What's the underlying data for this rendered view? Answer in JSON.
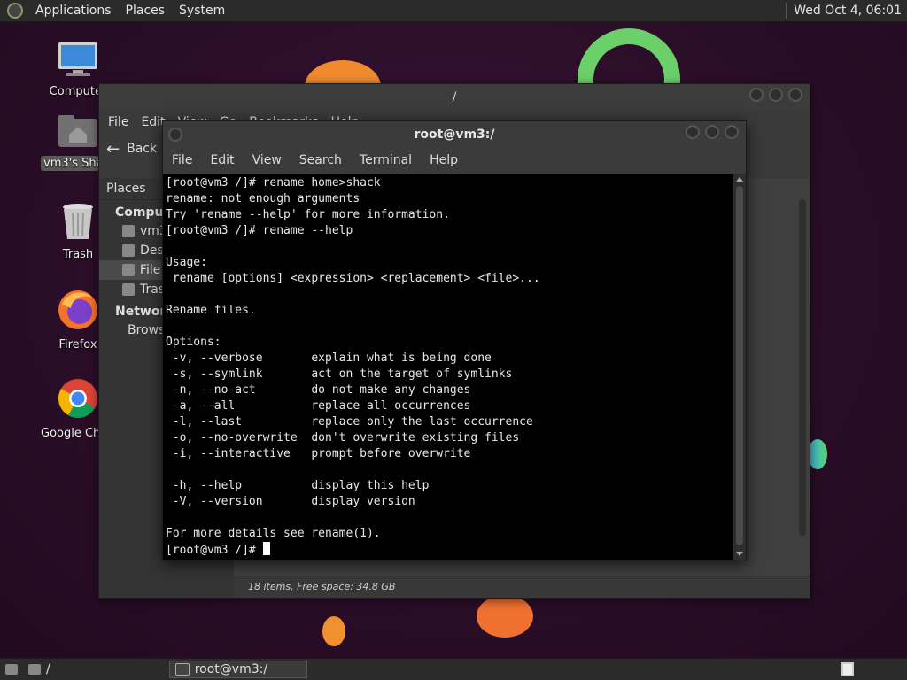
{
  "top_panel": {
    "menus": [
      "Applications",
      "Places",
      "System"
    ],
    "clock": "Wed Oct  4, 06:01"
  },
  "desktop": {
    "icons": [
      {
        "label": "Computer",
        "icon": "computer-icon"
      },
      {
        "label": "vm3's Shared",
        "icon": "home-folder-icon"
      },
      {
        "label": "Trash",
        "icon": "trash-icon"
      },
      {
        "label": "Firefox",
        "icon": "firefox-icon"
      },
      {
        "label": "Google Chrome",
        "icon": "chrome-icon"
      }
    ]
  },
  "file_manager": {
    "title": "/",
    "menus": [
      "File",
      "Edit",
      "View",
      "Go",
      "Bookmarks",
      "Help"
    ],
    "back_label": "Back",
    "sidebar_header": "Places",
    "section_computer": "Computer",
    "computer_items": [
      "vm3",
      "Desktop",
      "File System",
      "Trash"
    ],
    "section_network": "Network",
    "network_items": [
      "Browse Network"
    ],
    "status": "18 items, Free space: 34.8 GB"
  },
  "terminal": {
    "title": "root@vm3:/",
    "menus": [
      "File",
      "Edit",
      "View",
      "Search",
      "Terminal",
      "Help"
    ],
    "lines": [
      "[root@vm3 /]# rename home>shack",
      "rename: not enough arguments",
      "Try 'rename --help' for more information.",
      "[root@vm3 /]# rename --help",
      "",
      "Usage:",
      " rename [options] <expression> <replacement> <file>...",
      "",
      "Rename files.",
      "",
      "Options:",
      " -v, --verbose       explain what is being done",
      " -s, --symlink       act on the target of symlinks",
      " -n, --no-act        do not make any changes",
      " -a, --all           replace all occurrences",
      " -l, --last          replace only the last occurrence",
      " -o, --no-overwrite  don't overwrite existing files",
      " -i, --interactive   prompt before overwrite",
      "",
      " -h, --help          display this help",
      " -V, --version       display version",
      "",
      "For more details see rename(1)."
    ],
    "prompt": "[root@vm3 /]# "
  },
  "bottom_panel": {
    "tasks": [
      {
        "label": "/",
        "icon": "folder-icon"
      },
      {
        "label": "root@vm3:/",
        "icon": "terminal-icon"
      }
    ]
  }
}
